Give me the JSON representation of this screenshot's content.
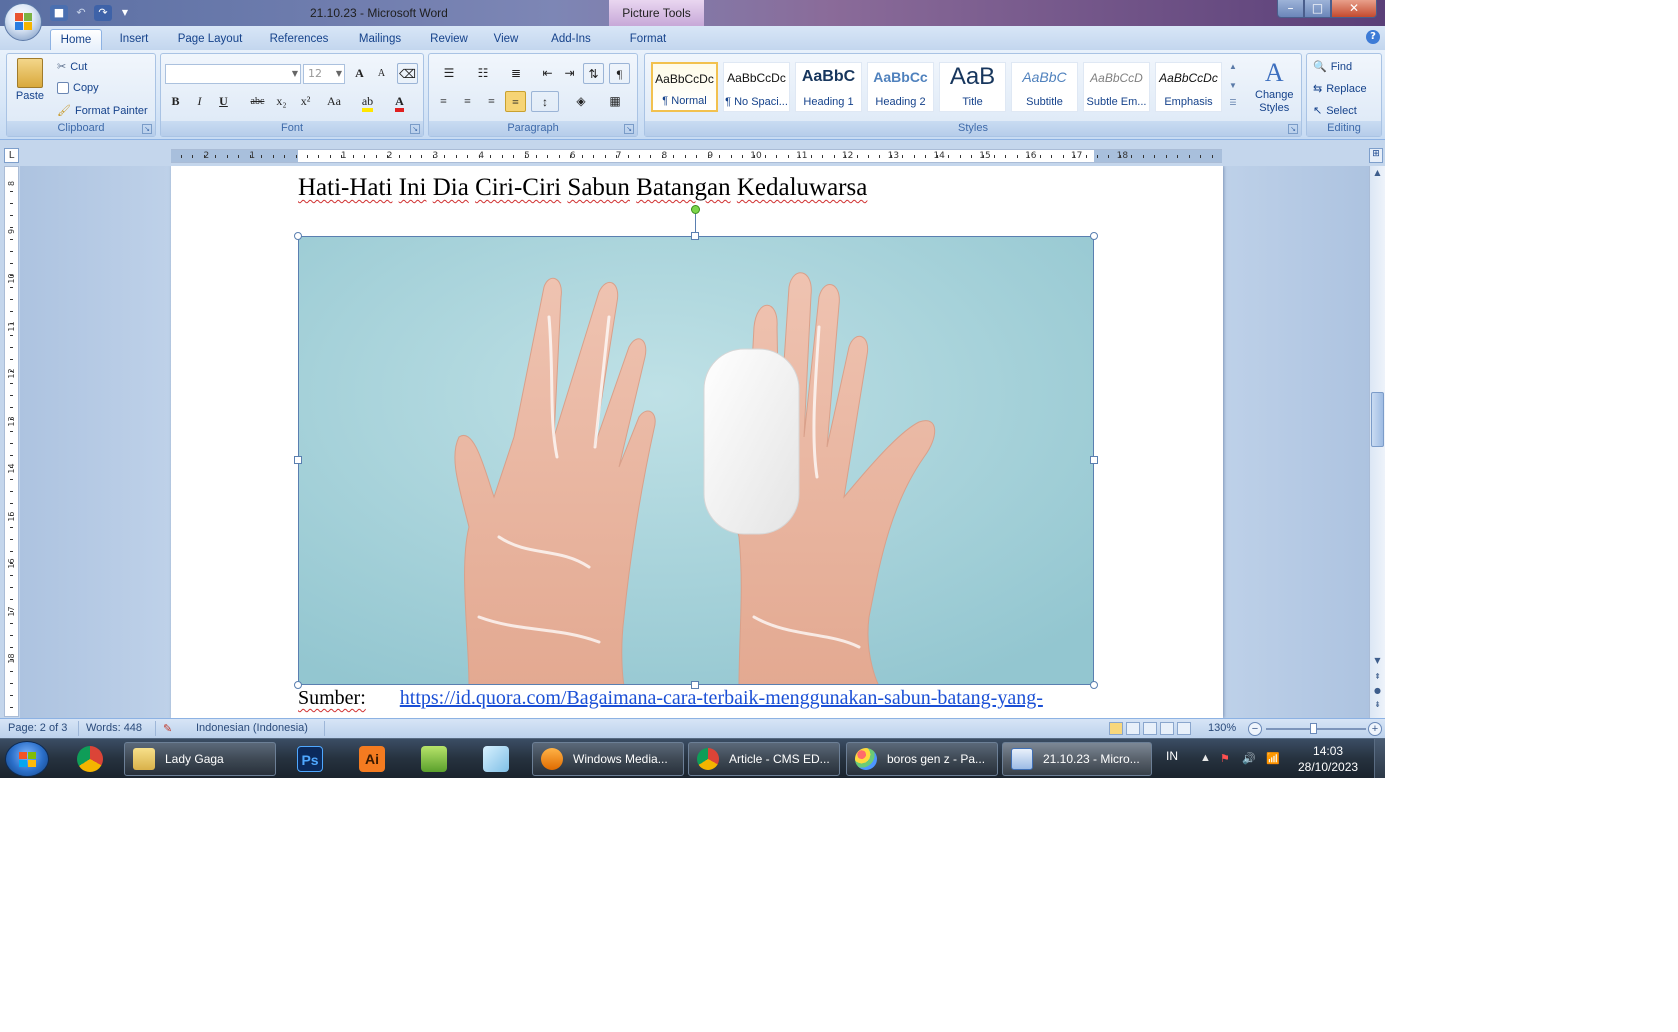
{
  "window": {
    "title": "21.10.23 - Microsoft Word",
    "context_tab": "Picture Tools",
    "controls": {
      "minimize": "–",
      "maximize": "□",
      "close": "✕"
    }
  },
  "tabs": [
    "Home",
    "Insert",
    "Page Layout",
    "References",
    "Mailings",
    "Review",
    "View",
    "Add-Ins",
    "Format"
  ],
  "active_tab": "Home",
  "ribbon": {
    "clipboard": {
      "label": "Clipboard",
      "paste": "Paste",
      "cut": "Cut",
      "copy": "Copy",
      "format_painter": "Format Painter"
    },
    "font": {
      "label": "Font",
      "font_name": "",
      "font_size": "12",
      "bold": "B",
      "italic": "I",
      "underline": "U",
      "strike": "abc",
      "subscript": "x₂",
      "superscript": "x²",
      "change_case": "Aa",
      "grow": "A",
      "shrink": "A"
    },
    "paragraph": {
      "label": "Paragraph",
      "show_marks": "¶"
    },
    "styles": {
      "label": "Styles",
      "items": [
        {
          "preview": "AaBbCcDc",
          "name": "¶ Normal"
        },
        {
          "preview": "AaBbCcDc",
          "name": "¶ No Spaci..."
        },
        {
          "preview": "AaBbC",
          "name": "Heading 1"
        },
        {
          "preview": "AaBbCc",
          "name": "Heading 2"
        },
        {
          "preview": "AaB",
          "name": "Title"
        },
        {
          "preview": "AaBbC",
          "name": "Subtitle"
        },
        {
          "preview": "AaBbCcD",
          "name": "Subtle Em..."
        },
        {
          "preview": "AaBbCcDc",
          "name": "Emphasis"
        }
      ],
      "change_styles_1": "Change",
      "change_styles_2": "Styles"
    },
    "editing": {
      "label": "Editing",
      "find": "Find",
      "replace": "Replace",
      "select": "Select"
    }
  },
  "ruler": {
    "corner": "L",
    "numbers": [
      "2",
      "1",
      "1",
      "2",
      "3",
      "4",
      "5",
      "6",
      "7",
      "8",
      "9",
      "10",
      "11",
      "12",
      "13",
      "14",
      "15",
      "16",
      "17",
      "18"
    ],
    "vertical_numbers": [
      "8",
      "9",
      "10",
      "11",
      "12",
      "13",
      "14",
      "15",
      "16",
      "17",
      "18"
    ]
  },
  "document": {
    "title": "Hati-Hati Ini Dia Ciri-Ciri Sabun Batangan Kedaluwarsa",
    "source_label": "Sumber:",
    "source_link": "https://id.quora.com/Bagaimana-cara-terbaik-menggunakan-sabun-batang-yang-"
  },
  "statusbar": {
    "page": "Page: 2 of 3",
    "words": "Words: 448",
    "language": "Indonesian (Indonesia)",
    "zoom": "130%"
  },
  "taskbar": {
    "items": [
      {
        "label": "Lady Gaga",
        "icon": "folder-icon"
      },
      {
        "label": "Windows Media...",
        "icon": "media-player-icon"
      },
      {
        "label": "Article - CMS ED...",
        "icon": "chrome-icon"
      },
      {
        "label": "boros gen z - Pa...",
        "icon": "paint-icon"
      },
      {
        "label": "21.10.23 - Micro...",
        "icon": "word-icon"
      }
    ],
    "pinned": [
      {
        "label": "",
        "icon": "chrome-icon"
      },
      {
        "label": "Ps",
        "icon": "photoshop-icon"
      },
      {
        "label": "Ai",
        "icon": "illustrator-icon"
      },
      {
        "label": "",
        "icon": "coreldraw-icon"
      },
      {
        "label": "",
        "icon": "notepad-icon"
      }
    ],
    "tray": {
      "language": "IN",
      "time": "14:03",
      "date": "28/10/2023"
    }
  },
  "colors": {
    "ribbon_text": "#15428b",
    "link": "#1a4fd6",
    "squiggle": "#d03030",
    "image_bg": "#a8d3dc"
  }
}
